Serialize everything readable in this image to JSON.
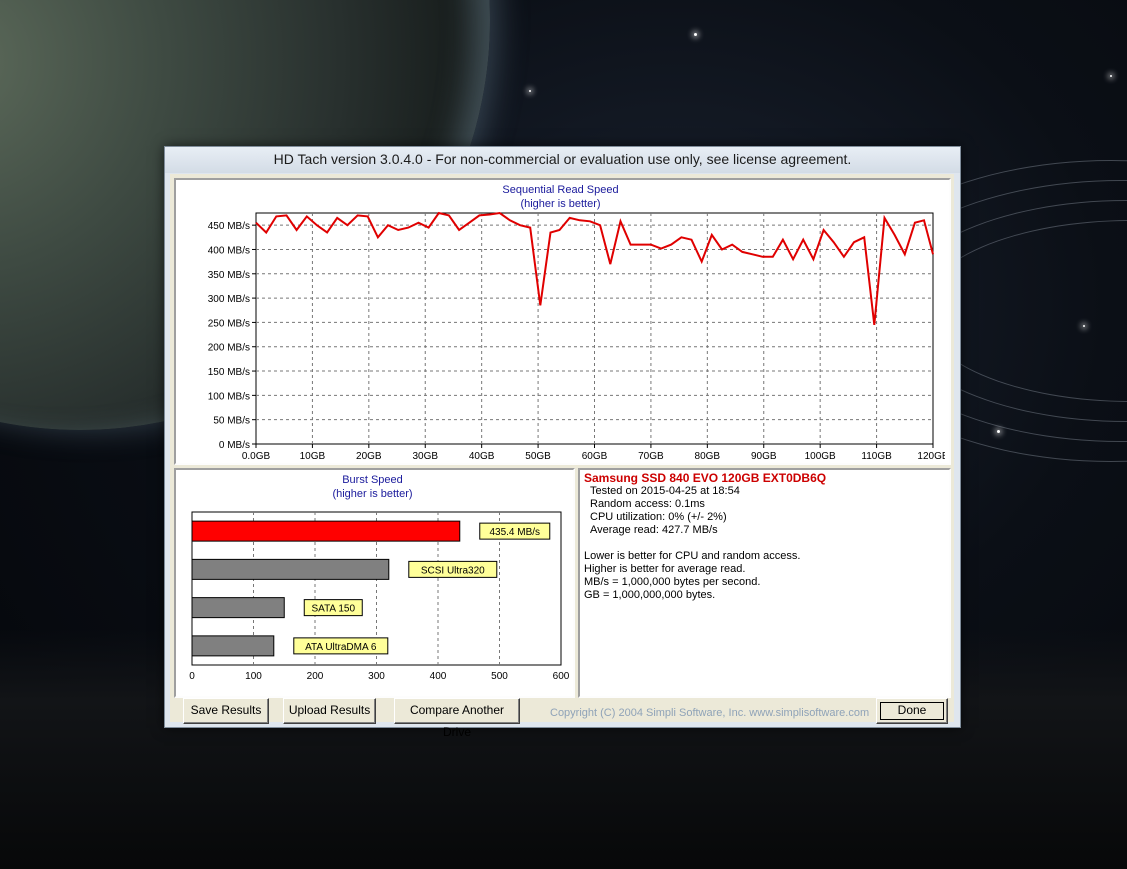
{
  "window": {
    "title": "HD Tach version 3.0.4.0  - For non-commercial or evaluation use only, see license agreement."
  },
  "sequential_chart": {
    "title_line1": "Sequential Read Speed",
    "title_line2": "(higher is better)"
  },
  "burst_chart": {
    "title_line1": "Burst Speed",
    "title_line2": "(higher is better)"
  },
  "chart_data": [
    {
      "type": "line",
      "title": "Sequential Read Speed",
      "subtitle": "(higher is better)",
      "x_tick_labels": [
        "0,0GB",
        "10GB",
        "20GB",
        "30GB",
        "40GB",
        "50GB",
        "60GB",
        "70GB",
        "80GB",
        "90GB",
        "100GB",
        "110GB",
        "120GB"
      ],
      "y_tick_labels": [
        "0 MB/s",
        "50 MB/s",
        "100 MB/s",
        "150 MB/s",
        "200 MB/s",
        "250 MB/s",
        "300 MB/s",
        "350 MB/s",
        "400 MB/s",
        "450 MB/s"
      ],
      "xlim": [
        0,
        120
      ],
      "ylim": [
        0,
        475
      ],
      "grid": true,
      "line_color": "#e00000",
      "series": [
        {
          "x": [
            0,
            1.8,
            3.6,
            5.4,
            7.2,
            9.0,
            10.8,
            12.6,
            14.4,
            16.2,
            18.0,
            19.8,
            21.6,
            23.4,
            25.2,
            27.0,
            28.8,
            30.6,
            32.4,
            34.2,
            36.0,
            37.8,
            39.6,
            41.4,
            43.2,
            45.0,
            46.8,
            48.6,
            50.4,
            52.2,
            53.8,
            55.6,
            57.4,
            59.2,
            61.0,
            62.8,
            64.6,
            66.4,
            68.2,
            70.0,
            71.8,
            73.6,
            75.4,
            77.2,
            79.0,
            80.8,
            82.6,
            84.4,
            86.2,
            88.0,
            89.8,
            91.6,
            93.4,
            95.2,
            97.0,
            98.8,
            100.6,
            102.4,
            104.2,
            106.0,
            107.8,
            109.6,
            111.4,
            113.2,
            115.0,
            116.8,
            118.4,
            120.0
          ],
          "y": [
            455,
            435,
            468,
            470,
            440,
            468,
            450,
            435,
            465,
            450,
            470,
            468,
            425,
            450,
            440,
            445,
            455,
            445,
            475,
            470,
            440,
            455,
            470,
            472,
            475,
            460,
            450,
            445,
            285,
            435,
            440,
            465,
            460,
            458,
            450,
            370,
            458,
            410,
            410,
            410,
            402,
            410,
            425,
            420,
            375,
            430,
            400,
            410,
            395,
            390,
            385,
            385,
            420,
            380,
            420,
            380,
            440,
            415,
            385,
            415,
            425,
            245,
            465,
            430,
            390,
            455,
            460,
            390
          ]
        }
      ]
    },
    {
      "type": "bar",
      "orientation": "horizontal",
      "title": "Burst Speed",
      "subtitle": "(higher is better)",
      "x_tick_labels": [
        "0",
        "100",
        "200",
        "300",
        "400",
        "500",
        "600"
      ],
      "xlim": [
        0,
        600
      ],
      "grid": true,
      "categories": [
        "435.4 MB/s",
        "SCSI Ultra320",
        "SATA 150",
        "ATA UltraDMA 6"
      ],
      "values": [
        435.4,
        320,
        150,
        133
      ],
      "colors": [
        "#ff0000",
        "#808080",
        "#808080",
        "#808080"
      ],
      "label_background": "#ffff99"
    }
  ],
  "info": {
    "drive_name": "Samsung SSD 840 EVO 120GB EXT0DB6Q",
    "tested_on": "Tested on 2015-04-25 at 18:54",
    "random_access": "Random access: 0.1ms",
    "cpu_utilization": "CPU utilization: 0% (+/- 2%)",
    "average_read": "Average read: 427.7 MB/s",
    "note1": "Lower is better for CPU and random access.",
    "note2": "Higher is better for average read.",
    "note3": "MB/s = 1,000,000 bytes per second.",
    "note4": "GB = 1,000,000,000 bytes."
  },
  "buttons": {
    "save": "Save Results",
    "upload": "Upload Results",
    "compare": "Compare Another Drive",
    "done": "Done"
  },
  "footer": {
    "copyright": "Copyright (C) 2004 Simpli Software, Inc. www.simplisoftware.com"
  }
}
